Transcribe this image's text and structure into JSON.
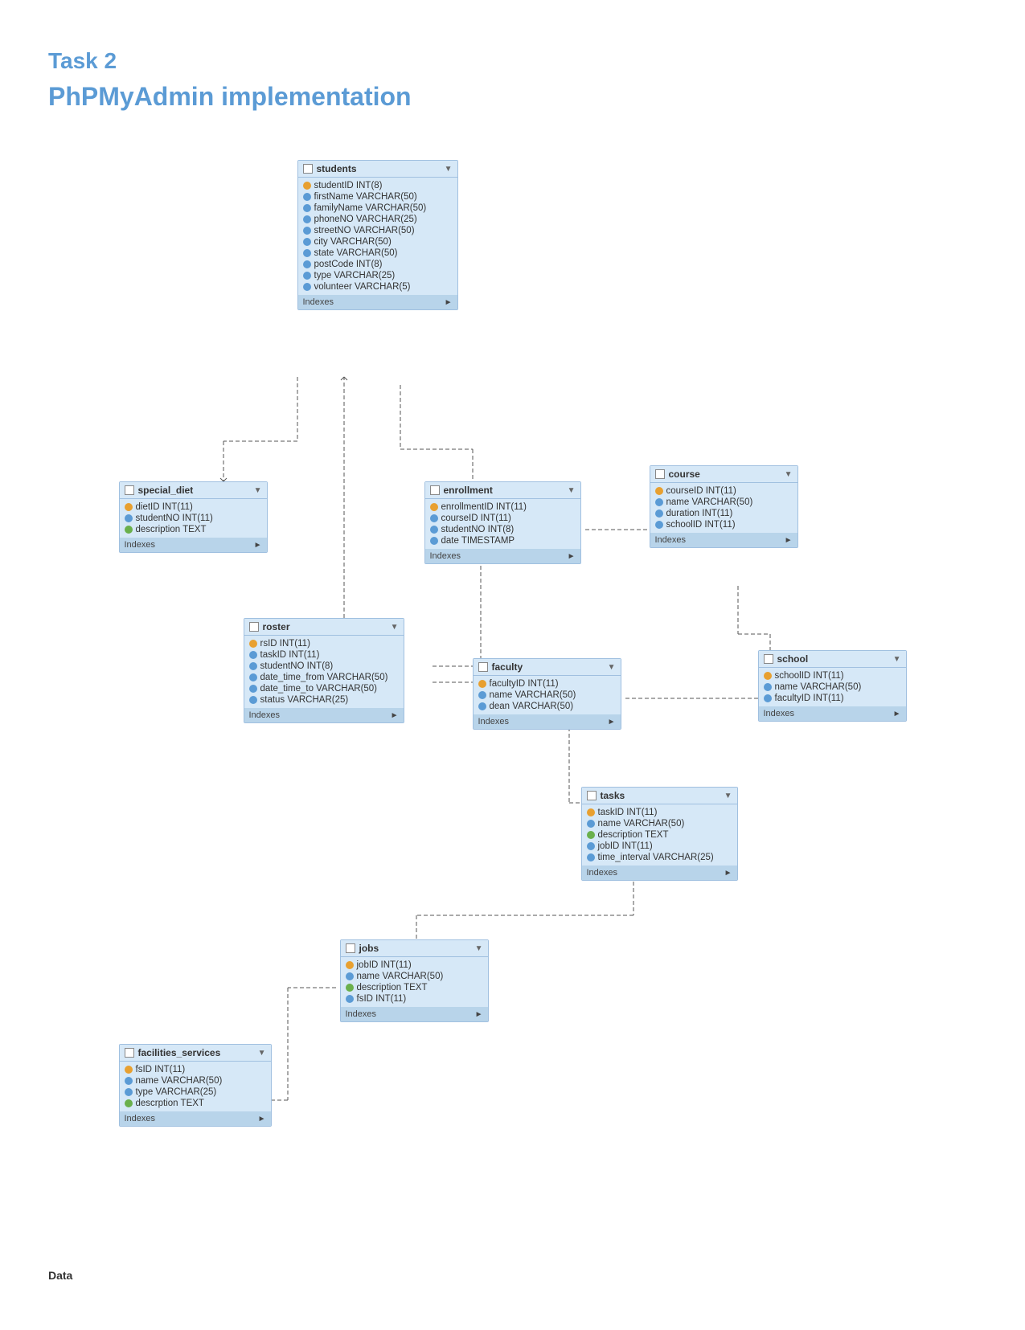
{
  "page": {
    "task_label": "Task 2",
    "section_label": "PhPMyAdmin implementation",
    "footer_label": "Data"
  },
  "tables": {
    "students": {
      "name": "students",
      "fields": [
        {
          "icon": "pk",
          "text": "studentID INT(8)"
        },
        {
          "icon": "fk",
          "text": "firstName VARCHAR(50)"
        },
        {
          "icon": "fk",
          "text": "familyName VARCHAR(50)"
        },
        {
          "icon": "fk",
          "text": "phoneNO VARCHAR(25)"
        },
        {
          "icon": "fk",
          "text": "streetNO VARCHAR(50)"
        },
        {
          "icon": "fk",
          "text": "city VARCHAR(50)"
        },
        {
          "icon": "fk",
          "text": "state VARCHAR(50)"
        },
        {
          "icon": "fk",
          "text": "postCode INT(8)"
        },
        {
          "icon": "fk",
          "text": "type VARCHAR(25)"
        },
        {
          "icon": "fk",
          "text": "volunteer VARCHAR(5)"
        }
      ],
      "indexes": "Indexes"
    },
    "special_diet": {
      "name": "special_diet",
      "fields": [
        {
          "icon": "pk",
          "text": "dietID INT(11)"
        },
        {
          "icon": "fk",
          "text": "studentNO INT(11)"
        },
        {
          "icon": "regular",
          "text": "description TEXT"
        }
      ],
      "indexes": "Indexes"
    },
    "enrollment": {
      "name": "enrollment",
      "fields": [
        {
          "icon": "pk",
          "text": "enrollmentID INT(11)"
        },
        {
          "icon": "fk",
          "text": "courseID INT(11)"
        },
        {
          "icon": "fk",
          "text": "studentNO INT(8)"
        },
        {
          "icon": "fk",
          "text": "date TIMESTAMP"
        }
      ],
      "indexes": "Indexes"
    },
    "course": {
      "name": "course",
      "fields": [
        {
          "icon": "pk",
          "text": "courseID INT(11)"
        },
        {
          "icon": "fk",
          "text": "name VARCHAR(50)"
        },
        {
          "icon": "fk",
          "text": "duration INT(11)"
        },
        {
          "icon": "fk",
          "text": "schoolID INT(11)"
        }
      ],
      "indexes": "Indexes"
    },
    "faculty": {
      "name": "faculty",
      "fields": [
        {
          "icon": "pk",
          "text": "facultyID INT(11)"
        },
        {
          "icon": "fk",
          "text": "name VARCHAR(50)"
        },
        {
          "icon": "fk",
          "text": "dean VARCHAR(50)"
        }
      ],
      "indexes": "Indexes"
    },
    "school": {
      "name": "school",
      "fields": [
        {
          "icon": "pk",
          "text": "schoolID INT(11)"
        },
        {
          "icon": "fk",
          "text": "name VARCHAR(50)"
        },
        {
          "icon": "fk",
          "text": "facultyID INT(11)"
        }
      ],
      "indexes": "Indexes"
    },
    "roster": {
      "name": "roster",
      "fields": [
        {
          "icon": "pk",
          "text": "rsID INT(11)"
        },
        {
          "icon": "fk",
          "text": "taskID INT(11)"
        },
        {
          "icon": "fk",
          "text": "studentNO INT(8)"
        },
        {
          "icon": "fk",
          "text": "date_time_from VARCHAR(50)"
        },
        {
          "icon": "fk",
          "text": "date_time_to VARCHAR(50)"
        },
        {
          "icon": "fk",
          "text": "status VARCHAR(25)"
        }
      ],
      "indexes": "Indexes"
    },
    "tasks": {
      "name": "tasks",
      "fields": [
        {
          "icon": "pk",
          "text": "taskID INT(11)"
        },
        {
          "icon": "fk",
          "text": "name VARCHAR(50)"
        },
        {
          "icon": "regular",
          "text": "description TEXT"
        },
        {
          "icon": "fk",
          "text": "jobID INT(11)"
        },
        {
          "icon": "fk",
          "text": "time_interval VARCHAR(25)"
        }
      ],
      "indexes": "Indexes"
    },
    "facilities_services": {
      "name": "facilities_services",
      "fields": [
        {
          "icon": "pk",
          "text": "fsID INT(11)"
        },
        {
          "icon": "fk",
          "text": "name VARCHAR(50)"
        },
        {
          "icon": "fk",
          "text": "type VARCHAR(25)"
        },
        {
          "icon": "regular",
          "text": "descrption TEXT"
        }
      ],
      "indexes": "Indexes"
    },
    "jobs": {
      "name": "jobs",
      "fields": [
        {
          "icon": "pk",
          "text": "jobID INT(11)"
        },
        {
          "icon": "fk",
          "text": "name VARCHAR(50)"
        },
        {
          "icon": "regular",
          "text": "description TEXT"
        },
        {
          "icon": "fk",
          "text": "fsID INT(11)"
        }
      ],
      "indexes": "Indexes"
    }
  }
}
